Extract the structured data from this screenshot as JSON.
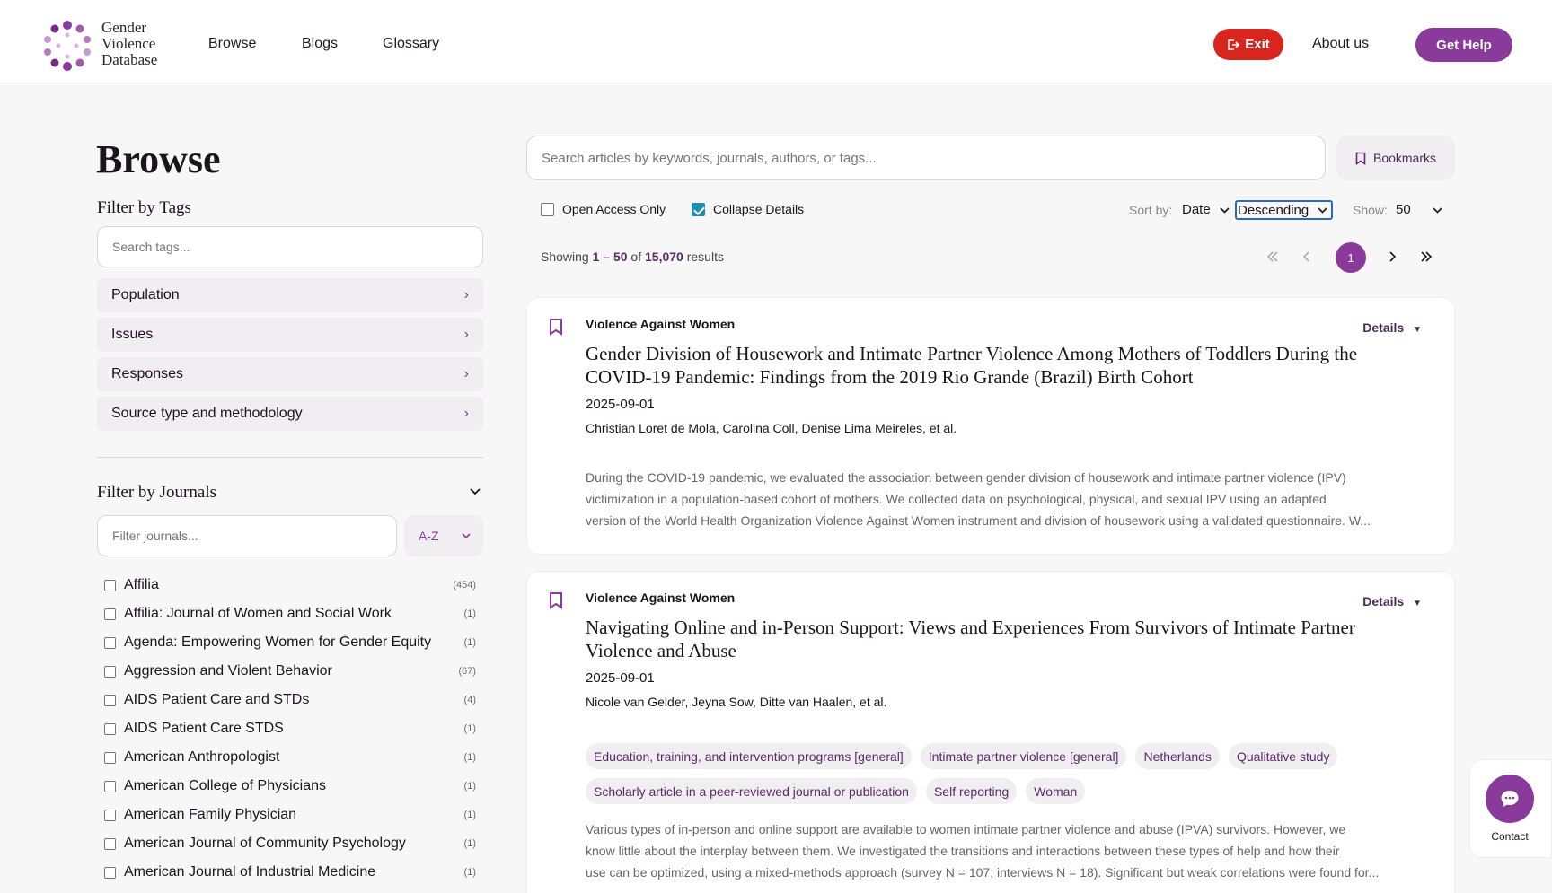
{
  "brand": {
    "line1": "Gender",
    "line2": "Violence",
    "line3": "Database"
  },
  "nav": {
    "browse": "Browse",
    "blogs": "Blogs",
    "glossary": "Glossary"
  },
  "header": {
    "exit": "Exit",
    "about": "About us",
    "help": "Get Help"
  },
  "sidebar": {
    "title": "Browse",
    "tags_title": "Filter by Tags",
    "tags_placeholder": "Search tags...",
    "categories": [
      "Population",
      "Issues",
      "Responses",
      "Source type and methodology"
    ],
    "journals_title": "Filter by Journals",
    "journals_placeholder": "Filter journals...",
    "sort_order": "A-Z",
    "journals": [
      {
        "name": "Affilia",
        "count": "(454)"
      },
      {
        "name": "Affilia: Journal of Women and Social Work",
        "count": "(1)"
      },
      {
        "name": "Agenda: Empowering Women for Gender Equity",
        "count": "(1)"
      },
      {
        "name": "Aggression and Violent Behavior",
        "count": "(67)"
      },
      {
        "name": "AIDS Patient Care and STDs",
        "count": "(4)"
      },
      {
        "name": "AIDS Patient Care STDS",
        "count": "(1)"
      },
      {
        "name": "American Anthropologist",
        "count": "(1)"
      },
      {
        "name": "American College of Physicians",
        "count": "(1)"
      },
      {
        "name": "American Family Physician",
        "count": "(1)"
      },
      {
        "name": "American Journal of Community Psychology",
        "count": "(1)"
      },
      {
        "name": "American Journal of Industrial Medicine",
        "count": "(1)"
      }
    ]
  },
  "main": {
    "search_placeholder": "Search articles by keywords, journals, authors, or tags...",
    "bookmarks": "Bookmarks",
    "open_access": "Open Access Only",
    "collapse": "Collapse Details",
    "sort_label": "Sort by:",
    "sort_value": "Date",
    "order_value": "Descending",
    "show_label": "Show:",
    "show_value": "50",
    "showing_prefix": "Showing",
    "showing_range": "1 – 50",
    "showing_of": "of",
    "showing_total": "15,070",
    "showing_suffix": "results",
    "current_page": "1"
  },
  "articles": [
    {
      "journal": "Violence Against Women",
      "details": "Details",
      "title": "Gender Division of Housework and Intimate Partner Violence Among Mothers of Toddlers During the COVID-19 Pandemic: Findings from the 2019 Rio Grande (Brazil) Birth Cohort",
      "date": "2025-09-01",
      "authors": "Christian Loret de Mola, Carolina Coll, Denise Lima Meireles, et al.",
      "abstract_lines": [
        "During the COVID-19 pandemic, we evaluated the association between gender division of housework and intimate partner violence (IPV)",
        "victimization in a population-based cohort of mothers. We collected data on psychological, physical, and sexual IPV using an adapted",
        "version of the World Health Organization Violence Against Women instrument and division of housework using a validated questionnaire. W..."
      ]
    },
    {
      "journal": "Violence Against Women",
      "details": "Details",
      "title": "Navigating Online and in-Person Support: Views and Experiences From Survivors of Intimate Partner Violence and Abuse",
      "date": "2025-09-01",
      "authors": "Nicole van Gelder, Jeyna Sow, Ditte van Haalen, et al.",
      "tags": [
        "Education, training, and intervention programs [general]",
        "Intimate partner violence [general]",
        "Netherlands",
        "Qualitative study",
        "Scholarly article in a peer-reviewed journal or publication",
        "Self reporting",
        "Woman"
      ],
      "abstract_lines": [
        "Various types of in-person and online support are available to women intimate partner violence and abuse (IPVA) survivors. However, we",
        "know little about the interplay between them. We investigated the transitions and interactions between these types of help and how their",
        "use can be optimized, using a mixed-methods approach (survey N = 107; interviews N = 18). Significant but weak correlations were found for..."
      ]
    }
  ],
  "contact": "Contact",
  "colors": {
    "accent": "#8a3a9a",
    "exit": "#d8261f"
  }
}
